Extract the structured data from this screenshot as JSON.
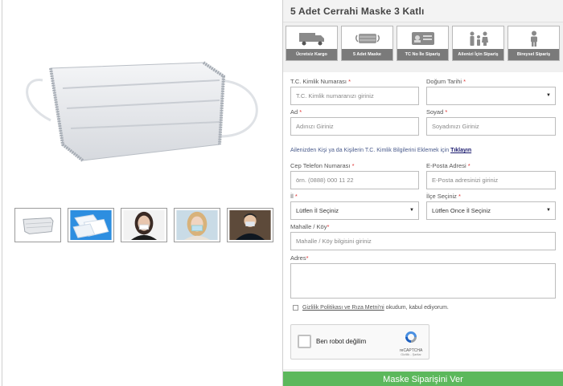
{
  "product": {
    "title": "5 Adet Cerrahi Maske 3 Katlı",
    "main_image_icon": "surgical-mask-image",
    "thumbnails": [
      {
        "icon": "mask-thumbnail"
      },
      {
        "icon": "masks-stack-thumbnail"
      },
      {
        "icon": "woman-mask-thumbnail"
      },
      {
        "icon": "woman-mask-thumbnail-2"
      },
      {
        "icon": "man-mask-thumbnail"
      }
    ]
  },
  "features": [
    {
      "label": "Ücretsiz Kargo",
      "icon": "truck-icon"
    },
    {
      "label": "5 Adet Maske",
      "icon": "mask-icon"
    },
    {
      "label": "TC No İle Sipariş",
      "icon": "id-card-icon"
    },
    {
      "label": "Ailenizi İçin Sipariş",
      "icon": "family-icon"
    },
    {
      "label": "Bireysel Sipariş",
      "icon": "person-icon"
    }
  ],
  "form": {
    "tc_label": "T.C. Kimlik Numarası",
    "tc_placeholder": "T.C. Kimlik numaranızı giriniz",
    "dob_label": "Doğum Tarihi",
    "dob_value": "",
    "ad_label": "Ad",
    "ad_placeholder": "Adınızı Giriniz",
    "soyad_label": "Soyad",
    "soyad_placeholder": "Soyadınızı Giriniz",
    "info_text": "Ailenizden Kişi ya da Kişilerin T.C. Kimlik Bilgilerini Eklemek için",
    "info_link": "Tıklayın",
    "phone_label": "Cep Telefon Numarası",
    "phone_placeholder": "örn. (0888) 000 11 22",
    "email_label": "E-Posta Adresi",
    "email_placeholder": "E-Posta adresinizi giriniz",
    "il_label": "İl",
    "il_value": "Lütfen İl Seçiniz",
    "ilce_label": "İlçe Seçiniz",
    "ilce_value": "Lütfen Once İl Seçiniz",
    "mahalle_label": "Mahalle / Köy",
    "mahalle_placeholder": "Mahalle / Köy bilgisini giriniz",
    "adres_label": "Adres",
    "consent_link": "Gizlilik Politikası ve Rıza Metni'ni",
    "consent_text": " okudum, kabul ediyorum.",
    "captcha_text": "Ben robot değilim",
    "captcha_brand": "reCAPTCHA",
    "captcha_terms": "Gizlilik - Şartlar",
    "submit_label": "Maske Siparişini Ver"
  },
  "colors": {
    "submit": "#5cb85c",
    "feature_label_bg": "#7a7a7a",
    "required": "#e03030",
    "info_text": "#4a5b8c"
  }
}
